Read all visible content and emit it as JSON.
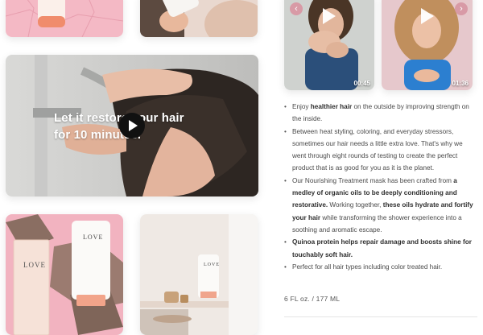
{
  "video": {
    "overlay_text": "Let it restore your hair\nfor 10 minutes."
  },
  "thumbnails": [
    {
      "duration": "00:45"
    },
    {
      "duration": "01:36"
    }
  ],
  "carousel": {
    "prev_icon": "‹",
    "next_icon": "›"
  },
  "description": {
    "items": [
      [
        "Enjoy ",
        {
          "b": "healthier hair"
        },
        " on the outside by improving strength on the inside."
      ],
      [
        "Between heat styling, coloring, and everyday stressors, sometimes our hair needs a little extra love. That's why we went through eight rounds of testing to create the perfect product that is as good for you as it is the planet."
      ],
      [
        "Our Nourishing Treatment mask has been crafted from ",
        {
          "b": "a medley of organic oils to be deeply conditioning and restorative."
        },
        " Working together, ",
        {
          "b": "these oils hydrate and fortify your hair"
        },
        " while transforming the shower experience into a soothing and aromatic escape."
      ],
      [
        {
          "b": "Quinoa protein helps repair damage and boosts shine for touchably soft hair."
        }
      ],
      [
        "Perfect for all hair types including color treated hair."
      ]
    ],
    "size": "6 FL oz. / 177 ML"
  },
  "product": {
    "brand": "LOVE"
  },
  "colors": {
    "accent_pink": "#f3b8c4",
    "arrow_pink": "#d89aa6"
  }
}
